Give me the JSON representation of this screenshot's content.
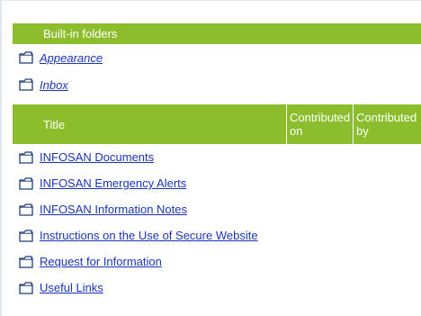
{
  "builtin": {
    "header": "Built-in folders",
    "items": [
      {
        "label": "Appearance",
        "icon": "folder-icon"
      },
      {
        "label": "Inbox",
        "icon": "folder-icon"
      }
    ]
  },
  "table": {
    "columns": [
      "Title",
      "Contributed on",
      "Contributed by"
    ],
    "rows": [
      {
        "label": "INFOSAN Documents",
        "icon": "folder-icon"
      },
      {
        "label": "INFOSAN Emergency Alerts",
        "icon": "folder-icon"
      },
      {
        "label": "INFOSAN Information Notes",
        "icon": "folder-icon"
      },
      {
        "label": "Instructions on the Use of Secure Website",
        "icon": "folder-icon"
      },
      {
        "label": "Request for Information",
        "icon": "folder-icon"
      },
      {
        "label": "Useful Links",
        "icon": "folder-icon"
      }
    ]
  },
  "colors": {
    "header_green": "#8cbd2c",
    "link_blue": "#1a35c4"
  }
}
